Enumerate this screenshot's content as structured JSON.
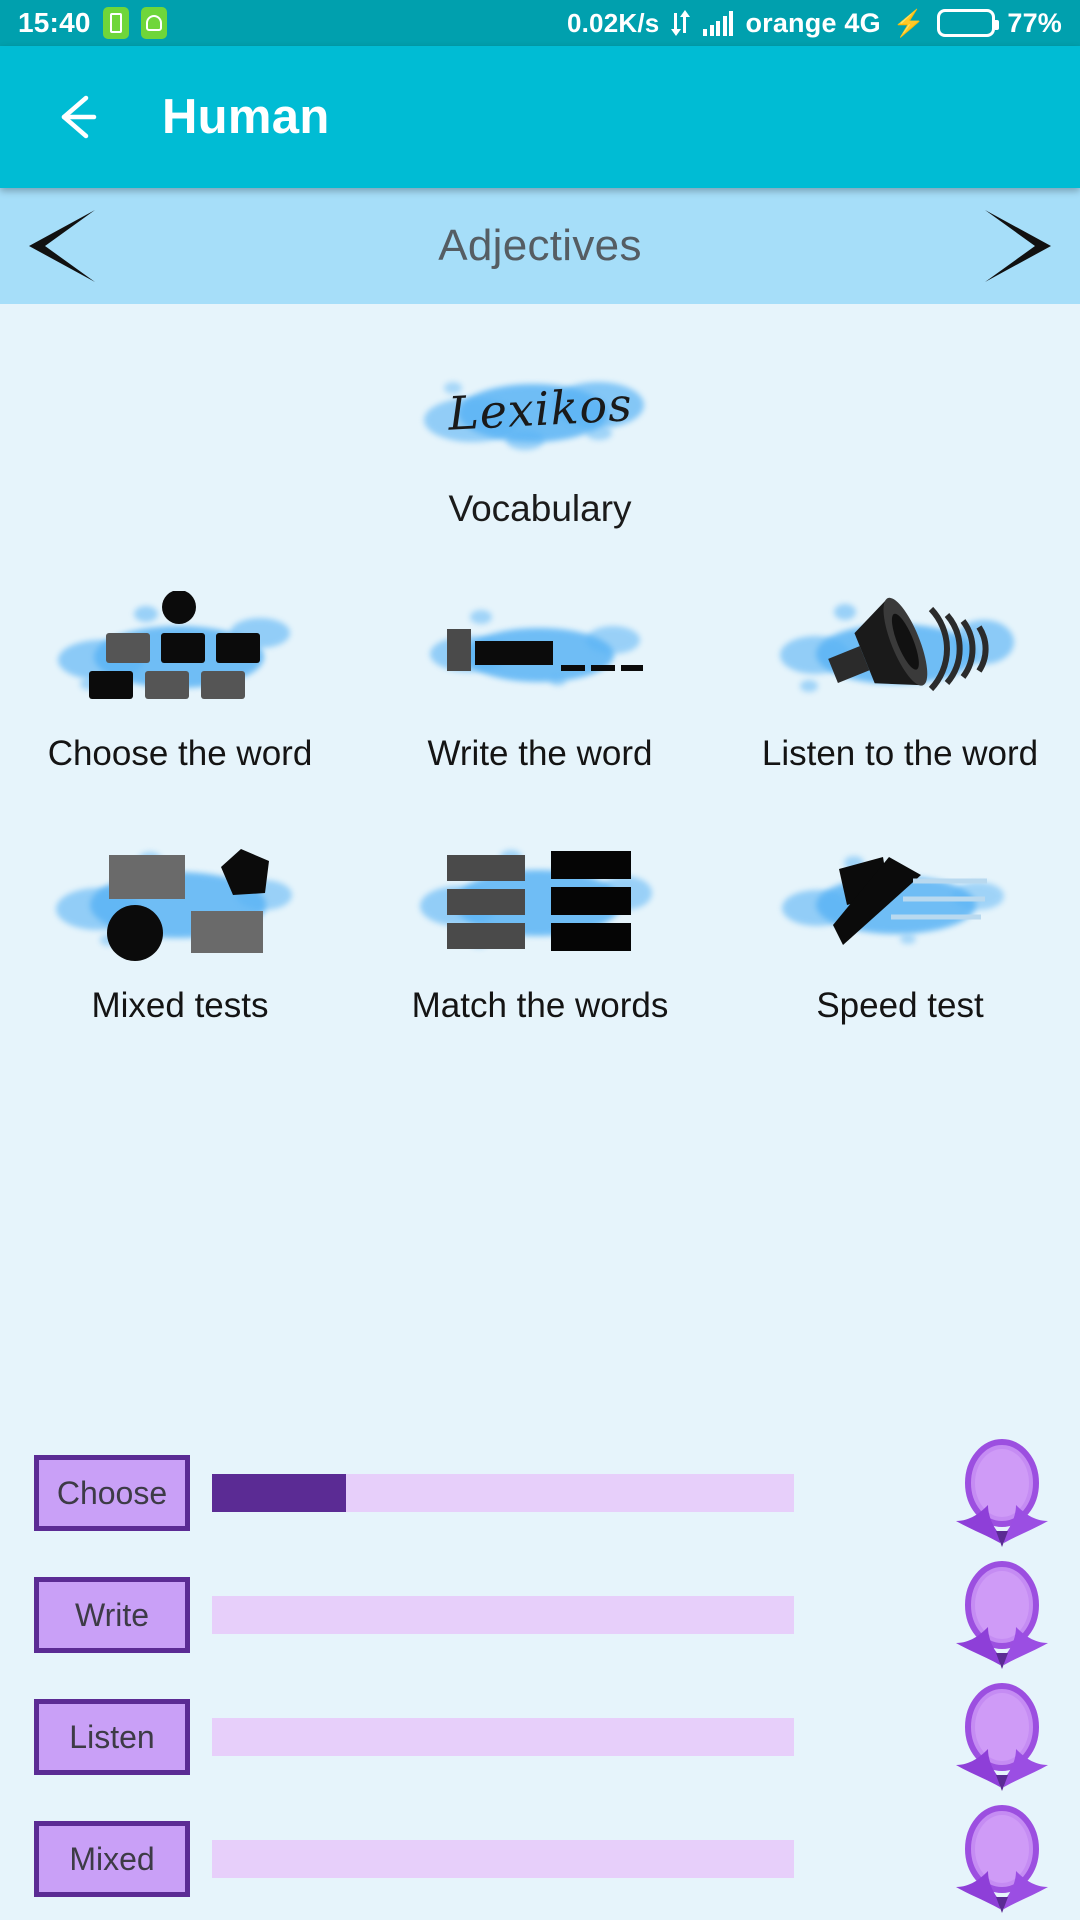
{
  "statusbar": {
    "time": "15:40",
    "app_icon_1": "battery-app-icon",
    "app_icon_2": "android-robot-icon",
    "network_speed": "0.02K/s",
    "data_transfer_icon": "up-down-arrows-icon",
    "signal_icon": "signal-bars-icon",
    "carrier": "orange 4G",
    "charging_icon": "lightning-bolt-icon",
    "battery_icon": "battery-icon",
    "battery_percent": "77%",
    "bg_color": "#00A0AE"
  },
  "appbar": {
    "back_icon": "back-arrow-icon",
    "title": "Human",
    "bg_color": "#00BCD4"
  },
  "category_nav": {
    "prev_icon": "chevron-left-icon",
    "title": "Adjectives",
    "next_icon": "chevron-right-icon",
    "bg_color": "#A6DEF9"
  },
  "vocabulary": {
    "logo_text": "Lexikos",
    "label": "Vocabulary"
  },
  "modes": [
    {
      "label": "Choose the word",
      "icon": "choose-the-word-icon"
    },
    {
      "label": "Write the word",
      "icon": "write-the-word-icon"
    },
    {
      "label": "Listen to the word",
      "icon": "listen-to-the-word-icon"
    },
    {
      "label": "Mixed tests",
      "icon": "mixed-tests-icon"
    },
    {
      "label": "Match the words",
      "icon": "match-the-words-icon"
    },
    {
      "label": "Speed test",
      "icon": "speed-test-icon"
    }
  ],
  "progress": {
    "track_color": "#E7CFFA",
    "fill_color": "#5B2B94",
    "chip_border_color": "#5B2B94",
    "chip_bg_color": "#C9A0F7",
    "rows": [
      {
        "label": "Choose",
        "percent": 23,
        "badge_icon": "laurel-badge-icon"
      },
      {
        "label": "Write",
        "percent": 0,
        "badge_icon": "laurel-badge-icon"
      },
      {
        "label": "Listen",
        "percent": 0,
        "badge_icon": "laurel-badge-icon"
      },
      {
        "label": "Mixed",
        "percent": 0,
        "badge_icon": "laurel-badge-icon"
      }
    ]
  },
  "page_bg_color": "#E6F4FB"
}
